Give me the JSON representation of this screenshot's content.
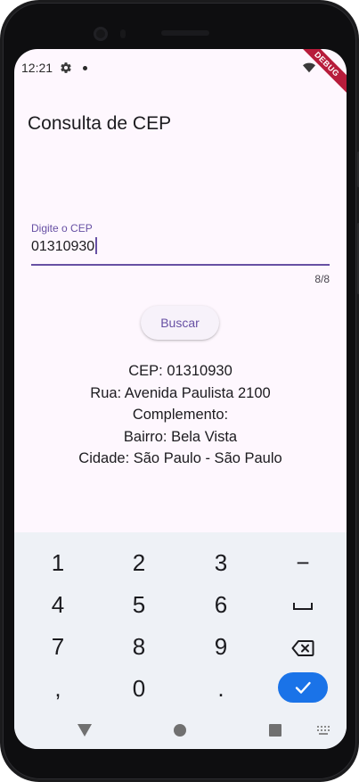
{
  "status_bar": {
    "time": "12:21",
    "debug_label": "DEBUG"
  },
  "app": {
    "title": "Consulta de CEP"
  },
  "cep_field": {
    "label": "Digite o CEP",
    "value": "01310930",
    "counter": "8/8"
  },
  "buscar_button": {
    "label": "Buscar"
  },
  "result": {
    "cep": "CEP: 01310930",
    "rua": "Rua: Avenida Paulista 2100",
    "complemento": "Complemento:",
    "bairro": "Bairro: Bela Vista",
    "cidade": "Cidade: São Paulo - São Paulo"
  },
  "keyboard": {
    "keys": {
      "k1": "1",
      "k2": "2",
      "k3": "3",
      "minus": "−",
      "k4": "4",
      "k5": "5",
      "k6": "6",
      "k7": "7",
      "k8": "8",
      "k9": "9",
      "comma": ",",
      "k0": "0",
      "period": "."
    },
    "accent_color": "#1a73e8"
  },
  "icons": {
    "settings": "gear-icon",
    "notification_dot": "dot-icon",
    "wifi": "wifi-icon",
    "space": "space-bar-icon",
    "backspace": "backspace-icon",
    "done": "checkmark-icon",
    "nav_back": "back-triangle-icon",
    "nav_home": "home-circle-icon",
    "nav_recents": "recents-square-icon",
    "nav_keyboard": "keyboard-switch-icon"
  },
  "colors": {
    "primary": "#6750a4",
    "surface": "#fef7fe",
    "debug_banner": "#b71c3b"
  }
}
